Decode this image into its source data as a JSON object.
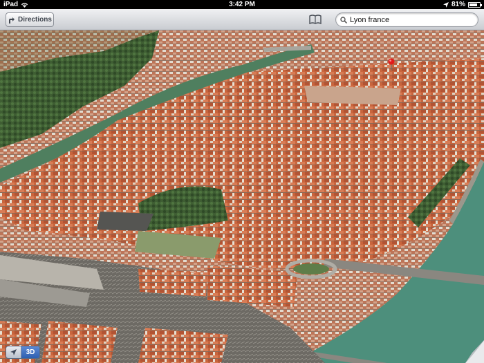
{
  "status_bar": {
    "device": "iPad",
    "time": "3:42 PM",
    "battery": "81%",
    "battery_level": 0.81,
    "icons": [
      "wifi-icon",
      "location-arrow-icon",
      "battery-icon"
    ]
  },
  "toolbar": {
    "directions_label": "Directions",
    "bookmarks_icon": "book-icon",
    "search": {
      "value": "Lyon france",
      "icon": "search-icon"
    }
  },
  "map": {
    "mode": "3D flyover",
    "pin_icon": "red-pin-icon",
    "colors": {
      "rooftops": "#c8653d",
      "river": "#4d8f7c",
      "vegetation": "#3f5e33",
      "roads": "#8f8e88"
    }
  },
  "controls": {
    "locate_icon": "location-arrow-icon",
    "mode_3d_label": "3D",
    "page_curl_icon": "page-curl-icon"
  }
}
